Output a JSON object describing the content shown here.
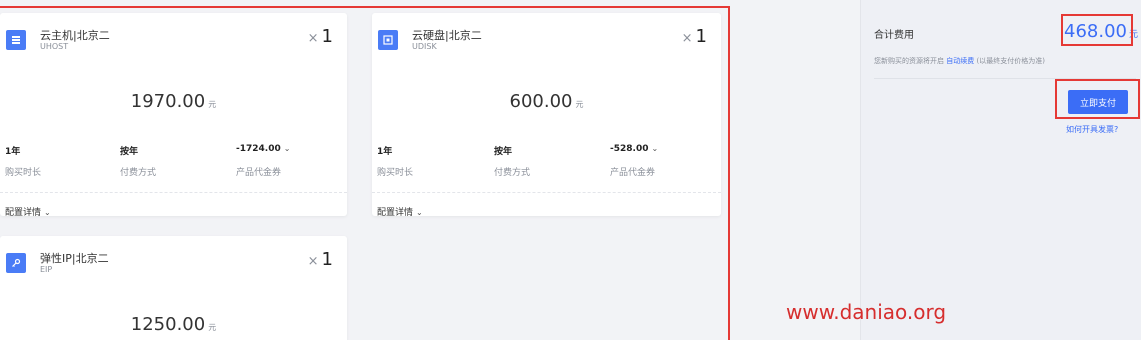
{
  "products": [
    {
      "name": "云主机|北京二",
      "code": "UHOST",
      "qty_prefix": "×",
      "qty": "1",
      "price": "1970.00",
      "currency": "元",
      "duration_value": "1年",
      "duration_label": "购买时长",
      "pay_value": "按年",
      "pay_label": "付费方式",
      "coupon_value": "-1724.00",
      "coupon_label": "产品代金券",
      "detail_label": "配置详情",
      "icon": "server-icon"
    },
    {
      "name": "云硬盘|北京二",
      "code": "UDISK",
      "qty_prefix": "×",
      "qty": "1",
      "price": "600.00",
      "currency": "元",
      "duration_value": "1年",
      "duration_label": "购买时长",
      "pay_value": "按年",
      "pay_label": "付费方式",
      "coupon_value": "-528.00",
      "coupon_label": "产品代金券",
      "detail_label": "配置详情",
      "icon": "disk-icon"
    },
    {
      "name": "弹性IP|北京二",
      "code": "EIP",
      "qty_prefix": "×",
      "qty": "1",
      "price": "1250.00",
      "currency": "元",
      "icon": "key-icon"
    }
  ],
  "summary": {
    "total_label": "合计费用",
    "total_price": "468.00",
    "currency": "元",
    "renew_prefix": "您新购买的资源将开启",
    "renew_link": "自动续费",
    "renew_suffix": "(以最终支付价格为准)",
    "pay_button": "立即支付",
    "invoice_link": "如何开具发票?"
  },
  "watermark": "www.daniao.org",
  "colors": {
    "accent": "#3b6df6",
    "highlight": "#e53935",
    "icon_bg": "#4a7cf6"
  }
}
